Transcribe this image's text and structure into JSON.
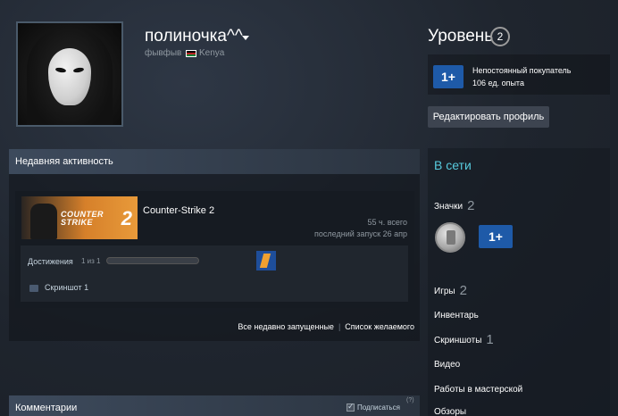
{
  "profile": {
    "username": "полиночка^^",
    "real_name": "фывфыв",
    "country": "Kenya",
    "level_label": "Уровень",
    "level": "2",
    "badge": {
      "name": "Непостоянный покупатель",
      "xp": "106 ед. опыта",
      "glyph": "1+"
    },
    "edit_button": "Редактировать профиль"
  },
  "recent": {
    "title": "Недавняя активность",
    "game": {
      "name": "Counter-Strike 2",
      "capsule_text": "COUNTER\nSTRIKE",
      "capsule_num": "2",
      "hours": "55 ч. всего",
      "last_played": "последний запуск 26 апр",
      "achievements_label": "Достижения",
      "achievements_count": "1 из 1",
      "achievements_progress": 0.0,
      "screenshot_label": "Скриншот 1"
    },
    "links": {
      "all_recent": "Все недавно запущенные",
      "wishlist": "Список желаемого"
    }
  },
  "comments": {
    "title": "Комментарии",
    "subscribe": "Подписаться",
    "help": "(?)"
  },
  "sidebar": {
    "status": "В сети",
    "badges_label": "Значки",
    "badges_count": "2",
    "badge_glyph": "1+",
    "games_label": "Игры",
    "games_count": "2",
    "inventory_label": "Инвентарь",
    "screenshots_label": "Скриншоты",
    "screenshots_count": "1",
    "video_label": "Видео",
    "workshop_label": "Работы в мастерской",
    "reviews_label": "Обзоры"
  }
}
